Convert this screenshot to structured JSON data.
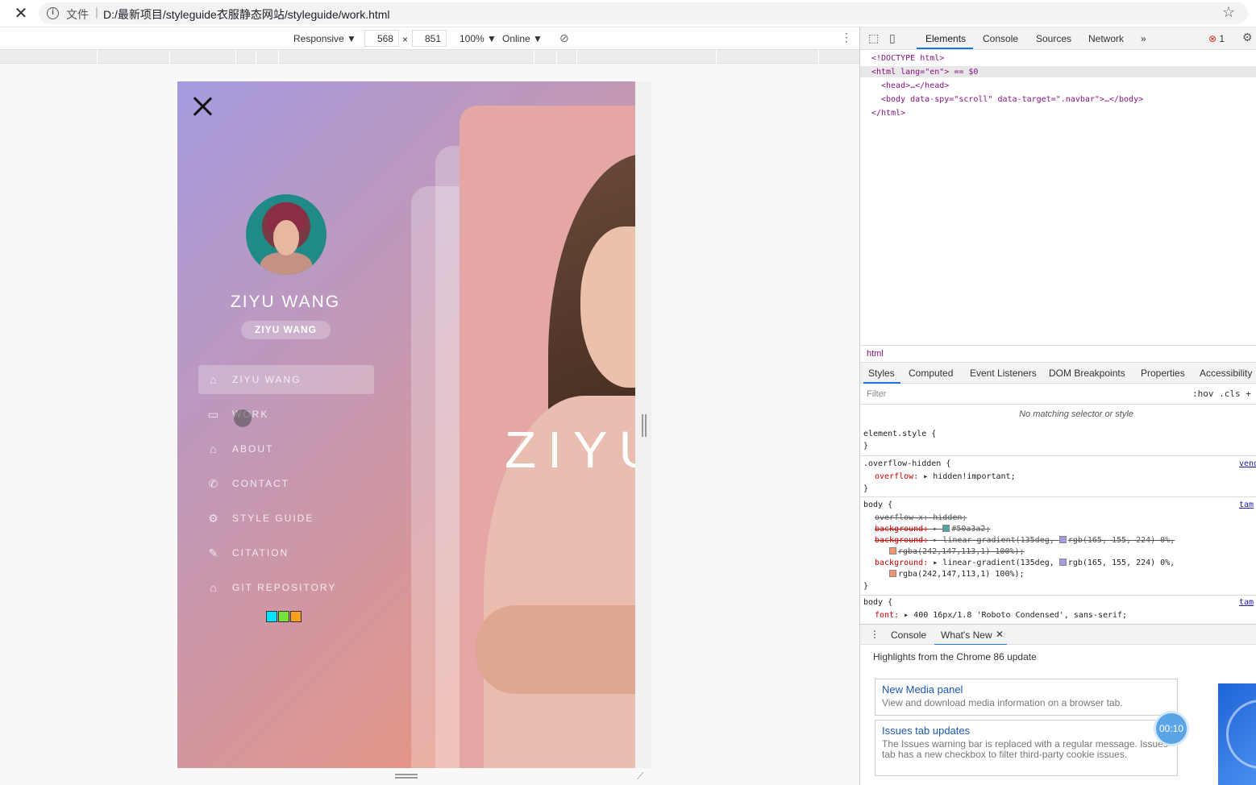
{
  "browser": {
    "file_label": "文件",
    "url": "D:/最新项目/styleguide衣服静态网站/styleguide/work.html"
  },
  "device_toolbar": {
    "mode": "Responsive ▼",
    "width": "568",
    "times": "×",
    "height": "851",
    "zoom": "100% ▼",
    "network": "Online ▼"
  },
  "app": {
    "name": "ZIYU WANG",
    "subname": "ZIYU WANG",
    "hero_text": "ZIYU",
    "nav": [
      {
        "label": "ZIYU WANG",
        "icon": "home-icon",
        "glyph": "⌂",
        "active": true
      },
      {
        "label": "WORK",
        "icon": "briefcase-icon",
        "glyph": "▭",
        "active": false
      },
      {
        "label": "ABOUT",
        "icon": "graduation-cap-icon",
        "glyph": "⌂",
        "active": false
      },
      {
        "label": "CONTACT",
        "icon": "phone-icon",
        "glyph": "✆",
        "active": false
      },
      {
        "label": "STYLE GUIDE",
        "icon": "gear-icon",
        "glyph": "⚙",
        "active": false
      },
      {
        "label": "CITATION",
        "icon": "pencil-icon",
        "glyph": "✎",
        "active": false
      },
      {
        "label": "GIT REPOSITORY",
        "icon": "graduation-cap-icon",
        "glyph": "⌂",
        "active": false
      }
    ],
    "swatches": [
      "#00e5ff",
      "#76e33a",
      "#ff9f1a"
    ]
  },
  "devtools": {
    "tabs": [
      "Elements",
      "Console",
      "Sources",
      "Network",
      "»"
    ],
    "error_count": "1",
    "dom": {
      "doctype": "<!DOCTYPE html>",
      "html_open": "<html lang=\"en\"> == $0",
      "head": "<head>…</head>",
      "body": "<body data-spy=\"scroll\" data-target=\".navbar\">…</body>",
      "html_close": "</html>"
    },
    "breadcrumb": "html",
    "style_tabs": [
      "Styles",
      "Computed",
      "Event Listeners",
      "DOM Breakpoints",
      "Properties",
      "Accessibility"
    ],
    "filter_placeholder": "Filter",
    "filter_right": ":hov .cls +",
    "no_match": "No matching selector or style",
    "css": {
      "element_style": "element.style {",
      "close": "}",
      "overflow_hidden_sel": ".overflow-hidden {",
      "overflow_hidden_prop": "overflow:",
      "overflow_hidden_val": "hidden!important;",
      "vendor_src": "vendor",
      "body_sel": "body {",
      "body_src": "tam",
      "overflow_x": "overflow-x: hidden;",
      "bg1_prop": "background:",
      "bg1_val": "#50a3a2;",
      "bg2_prop": "background:",
      "bg2_val": "linear-gradient(135deg, ",
      "bg2_val_b": "rgb(165, 155, 224) 0%,",
      "bg2_val_c": "rgba(242,147,113,1) 100%);",
      "bg3_prop": "background:",
      "bg3_val": "linear-gradient(135deg, ",
      "bg3_val_b": "rgb(165, 155, 224) 0%,",
      "bg3_val_c": "rgba(242,147,113,1) 100%);",
      "font_prop": "font:",
      "font_val": "400 16px/1.8 'Roboto Condensed', sans-serif;",
      "color_teal": "#50a3a2",
      "color_purple": "#a59be0",
      "color_orange": "#f29371"
    },
    "drawer_tabs": [
      "Console",
      "What's New"
    ],
    "highlights": "Highlights from the Chrome 86 update",
    "whats_new": [
      {
        "title": "New Media panel",
        "desc": "View and download media information on a browser tab."
      },
      {
        "title": "Issues tab updates",
        "desc": "The Issues warning bar is replaced with a regular message. Issues tab has a new checkbox to filter third-party cookie issues."
      }
    ],
    "timer": "00:10"
  }
}
